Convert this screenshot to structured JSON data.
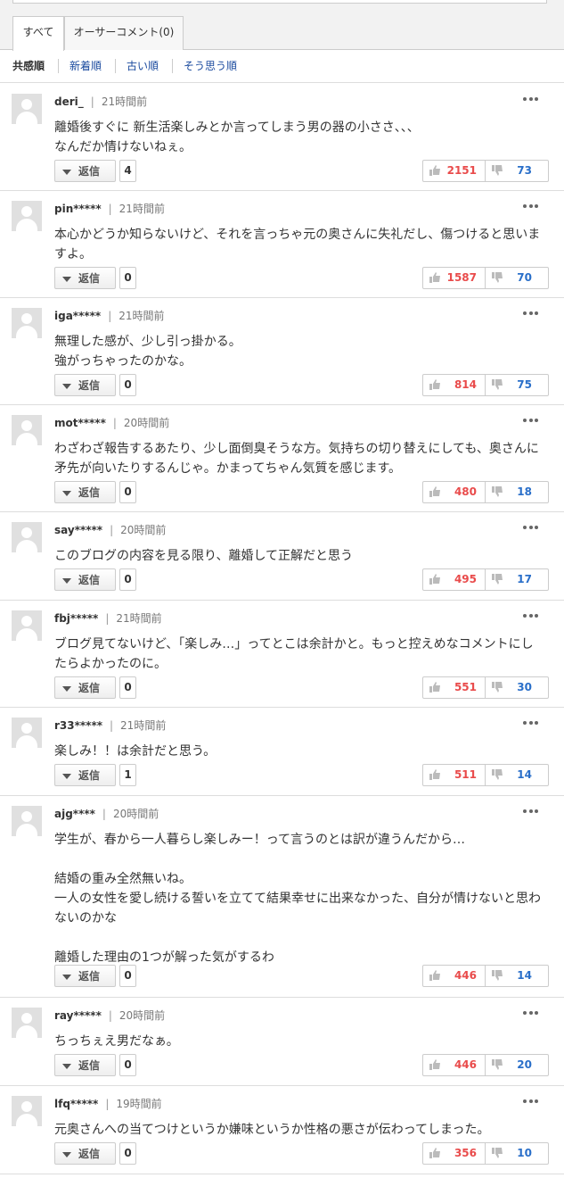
{
  "tabs": {
    "all": "すべて",
    "author": "オーサーコメント(0)"
  },
  "sort": {
    "empathy": "共感順",
    "newest": "新着順",
    "oldest": "古い順",
    "agree": "そう思う順"
  },
  "reply_label": "返信",
  "comments": [
    {
      "user": "deri_",
      "time": "21時間前",
      "text": "離婚後すぐに 新生活楽しみとか言ってしまう男の器の小ささ、、、\nなんだか情けないねぇ。",
      "replies": "4",
      "up": "2151",
      "down": "73"
    },
    {
      "user": "pin*****",
      "time": "21時間前",
      "text": "本心かどうか知らないけど、それを言っちゃ元の奥さんに失礼だし、傷つけると思いますよ。",
      "replies": "0",
      "up": "1587",
      "down": "70"
    },
    {
      "user": "iga*****",
      "time": "21時間前",
      "text": "無理した感が、少し引っ掛かる。\n強がっちゃったのかな。",
      "replies": "0",
      "up": "814",
      "down": "75"
    },
    {
      "user": "mot*****",
      "time": "20時間前",
      "text": "わざわざ報告するあたり、少し面倒臭そうな方。気持ちの切り替えにしても、奥さんに矛先が向いたりするんじゃ。かまってちゃん気質を感じます。",
      "replies": "0",
      "up": "480",
      "down": "18"
    },
    {
      "user": "say*****",
      "time": "20時間前",
      "text": "このブログの内容を見る限り、離婚して正解だと思う",
      "replies": "0",
      "up": "495",
      "down": "17"
    },
    {
      "user": "fbj*****",
      "time": "21時間前",
      "text": "ブログ見てないけど、「楽しみ…」ってとこは余計かと。もっと控えめなコメントにしたらよかったのに。",
      "replies": "0",
      "up": "551",
      "down": "30"
    },
    {
      "user": "r33*****",
      "time": "21時間前",
      "text": "楽しみ！！は余計だと思う。",
      "replies": "1",
      "up": "511",
      "down": "14"
    },
    {
      "user": "ajg****",
      "time": "20時間前",
      "text": "学生が、春から一人暮らし楽しみー！って言うのとは訳が違うんだから…\n\n結婚の重み全然無いね。\n一人の女性を愛し続ける誓いを立てて結果幸せに出来なかった、自分が情けないと思わないのかな\n\n離婚した理由の1つが解った気がするわ",
      "replies": "0",
      "up": "446",
      "down": "14"
    },
    {
      "user": "ray*****",
      "time": "20時間前",
      "text": "ちっちぇえ男だなぁ。",
      "replies": "0",
      "up": "446",
      "down": "20"
    },
    {
      "user": "lfq*****",
      "time": "19時間前",
      "text": "元奥さんへの当てつけというか嫌味というか性格の悪さが伝わってしまった。",
      "replies": "0",
      "up": "356",
      "down": "10"
    }
  ]
}
